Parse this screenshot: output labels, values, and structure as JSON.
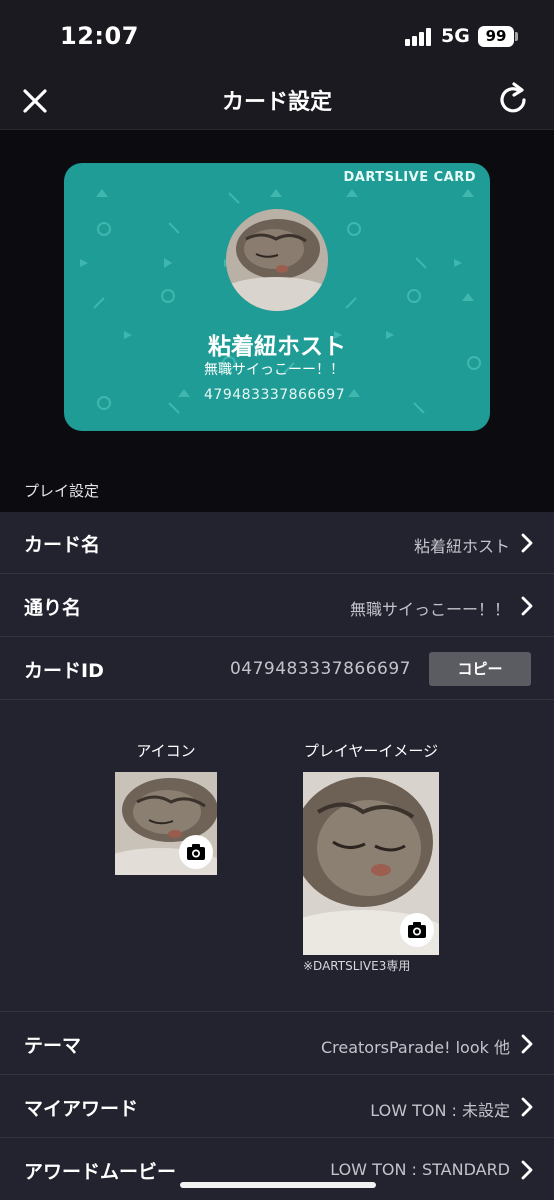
{
  "status": {
    "time": "12:07",
    "network": "5G",
    "battery": "99"
  },
  "nav": {
    "title": "カード設定",
    "close_icon": "close-icon",
    "refresh_icon": "refresh-icon"
  },
  "card": {
    "brand": "DARTSLIVE CARD",
    "name": "粘着紐ホスト",
    "subtitle": "無職サイっこーー！！",
    "id": "479483337866697",
    "color": "#1f9c95"
  },
  "section": {
    "title": "プレイ設定"
  },
  "rows": {
    "card_name": {
      "label": "カード名",
      "value": "粘着紐ホスト"
    },
    "street_name": {
      "label": "通り名",
      "value": "無職サイっこーー！！"
    },
    "card_id": {
      "label": "カードID",
      "value": "0479483337866697",
      "copy_label": "コピー"
    },
    "theme": {
      "label": "テーマ",
      "value": "CreatorsParade! look 他"
    },
    "my_award": {
      "label": "マイアワード",
      "value": "LOW TON : 未設定"
    },
    "award_movie": {
      "label": "アワードムービー",
      "value": "LOW TON : STANDARD"
    }
  },
  "images": {
    "icon_label": "アイコン",
    "player_label": "プレイヤーイメージ",
    "note": "※DARTSLIVE3専用"
  },
  "colors": {
    "background": "#0c0b10",
    "list": "#232330",
    "accent": "#1f9c95"
  }
}
